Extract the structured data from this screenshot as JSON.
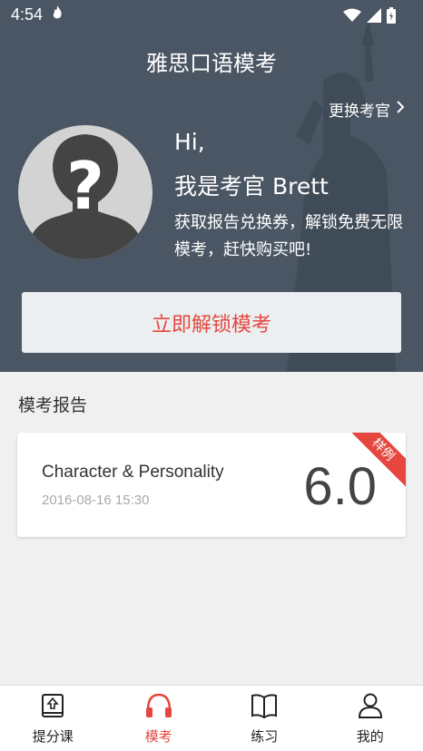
{
  "status": {
    "time": "4:54",
    "extra_icon": "flame-icon"
  },
  "header": {
    "title": "雅思口语模考",
    "change_examiner": "更换考官"
  },
  "examiner": {
    "hi": "Hi,",
    "name": "我是考官 Brett",
    "description": "获取报告兑换券，解锁免费无限模考，赶快购买吧!"
  },
  "unlock_button": "立即解锁模考",
  "reports": {
    "section_title": "模考报告",
    "items": [
      {
        "name": "Character & Personality",
        "date": "2016-08-16 15:30",
        "score": "6.0",
        "badge": "样例"
      }
    ]
  },
  "nav": {
    "items": [
      {
        "label": "提分课",
        "icon": "upgrade-book-icon"
      },
      {
        "label": "模考",
        "icon": "headphones-icon"
      },
      {
        "label": "练习",
        "icon": "open-book-icon"
      },
      {
        "label": "我的",
        "icon": "user-icon"
      }
    ],
    "active": "模考"
  },
  "colors": {
    "accent": "#e5473f",
    "header_bg": "#4a5663"
  }
}
